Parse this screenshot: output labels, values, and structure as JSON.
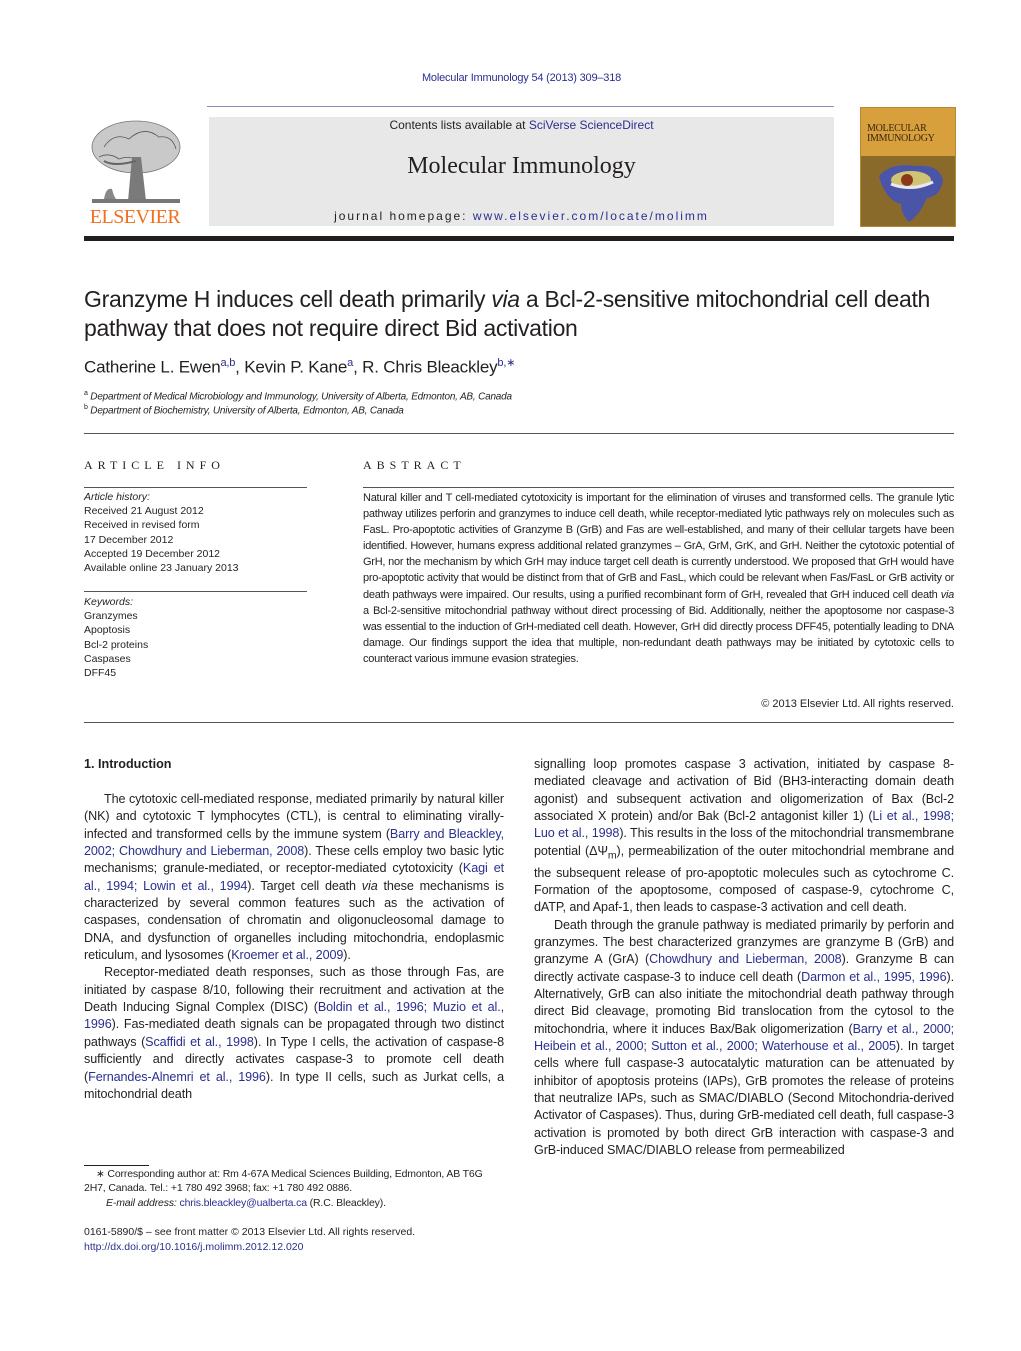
{
  "header": {
    "journal_ref": "Molecular Immunology 54 (2013) 309–318",
    "contents_prefix": "Contents lists available at ",
    "contents_link": "SciVerse ScienceDirect",
    "journal_title": "Molecular Immunology",
    "homepage_prefix": "journal homepage: ",
    "homepage_link": "www.elsevier.com/locate/molimm",
    "publisher_logo_text": "ELSEVIER",
    "cover_title_line1": "MOLECULAR",
    "cover_title_line2": "IMMUNOLOGY",
    "colors": {
      "link": "#2a2f8f",
      "elsevier_orange": "#f26f21",
      "header_box": "#e8e8e8"
    }
  },
  "article": {
    "title_part1": "Granzyme H induces cell death primarily ",
    "title_italic": "via",
    "title_part2": " a Bcl-2-sensitive mitochondrial cell death pathway that does not require direct Bid activation",
    "authors": [
      {
        "name": "Catherine L. Ewen",
        "sup": "a,b",
        "sep": ", "
      },
      {
        "name": "Kevin P. Kane",
        "sup": "a",
        "sep": ", "
      },
      {
        "name": "R. Chris Bleackley",
        "sup": "b,∗",
        "sep": ""
      }
    ],
    "affiliations": [
      {
        "sup": "a",
        "text": "Department of Medical Microbiology and Immunology, University of Alberta, Edmonton, AB, Canada"
      },
      {
        "sup": "b",
        "text": "Department of Biochemistry, University of Alberta, Edmonton, AB, Canada"
      }
    ]
  },
  "article_info": {
    "heading": "ARTICLE INFO",
    "history_label": "Article history:",
    "history": [
      "Received 21 August 2012",
      "Received in revised form",
      "17 December 2012",
      "Accepted 19 December 2012",
      "Available online 23 January 2013"
    ],
    "keywords_label": "Keywords:",
    "keywords": [
      "Granzymes",
      "Apoptosis",
      "Bcl-2 proteins",
      "Caspases",
      "DFF45"
    ]
  },
  "abstract": {
    "heading": "ABSTRACT",
    "text_part1": "Natural killer and T cell-mediated cytotoxicity is important for the elimination of viruses and transformed cells. The granule lytic pathway utilizes perforin and granzymes to induce cell death, while receptor-mediated lytic pathways rely on molecules such as FasL. Pro-apoptotic activities of Granzyme B (GrB) and Fas are well-established, and many of their cellular targets have been identified. However, humans express additional related granzymes – GrA, GrM, GrK, and GrH. Neither the cytotoxic potential of GrH, nor the mechanism by which GrH may induce target cell death is currently understood. We proposed that GrH would have pro-apoptotic activity that would be distinct from that of GrB and FasL, which could be relevant when Fas/FasL or GrB activity or death pathways were impaired. Our results, using a purified recombinant form of GrH, revealed that GrH induced cell death ",
    "text_italic": "via",
    "text_part2": " a Bcl-2-sensitive mitochondrial pathway without direct processing of Bid. Additionally, neither the apoptosome nor caspase-3 was essential to the induction of GrH-mediated cell death. However, GrH did directly process DFF45, potentially leading to DNA damage. Our findings support the idea that multiple, non-redundant death pathways may be initiated by cytotoxic cells to counteract various immune evasion strategies.",
    "copyright": "© 2013 Elsevier Ltd. All rights reserved."
  },
  "body": {
    "section_heading": "1.  Introduction",
    "left": {
      "p1": {
        "t1": "The cytotoxic cell-mediated response, mediated primarily by natural killer (NK) and cytotoxic T lymphocytes (CTL), is central to eliminating virally-infected and transformed cells by the immune system (",
        "c1": "Barry and Bleackley, 2002; Chowdhury and Lieberman, 2008",
        "t2": "). These cells employ two basic lytic mechanisms; granule-mediated, or receptor-mediated cytotoxicity (",
        "c2": "Kagi et al., 1994; Lowin et al., 1994",
        "t3": "). Target cell death ",
        "it": "via",
        "t4": " these mechanisms is characterized by several common features such as the activation of caspases, condensation of chromatin and oligonucleosomal damage to DNA, and dysfunction of organelles including mitochondria, endoplasmic reticulum, and lysosomes (",
        "c3": "Kroemer et al., 2009",
        "t5": ")."
      },
      "p2": {
        "t1": "Receptor-mediated death responses, such as those through Fas, are initiated by caspase 8/10, following their recruitment and activation at the Death Inducing Signal Complex (DISC) (",
        "c1": "Boldin et al., 1996; Muzio et al., 1996",
        "t2": "). Fas-mediated death signals can be propagated through two distinct pathways (",
        "c2": "Scaffidi et al., 1998",
        "t3": "). In Type I cells, the activation of caspase-8 sufficiently and directly activates caspase-3 to promote cell death (",
        "c3": "Fernandes-Alnemri et al., 1996",
        "t4": "). In type II cells, such as Jurkat cells, a mitochondrial death"
      }
    },
    "right": {
      "p1": {
        "t1": "signalling loop promotes caspase 3 activation, initiated by caspase 8-mediated cleavage and activation of Bid (BH3-interacting domain death agonist) and subsequent activation and oligomerization of Bax (Bcl-2 associated X protein) and/or Bak (Bcl-2 antagonist killer 1) (",
        "c1": "Li et al., 1998; Luo et al., 1998",
        "t2": "). This results in the loss of the mitochondrial transmembrane potential (ΔΨ",
        "sub": "m",
        "t3": "), permeabilization of the outer mitochondrial membrane and the subsequent release of pro-apoptotic molecules such as cytochrome C. Formation of the apoptosome, composed of caspase-9, cytochrome C, dATP, and Apaf-1, then leads to caspase-3 activation and cell death."
      },
      "p2": {
        "t1": "Death through the granule pathway is mediated primarily by perforin and granzymes. The best characterized granzymes are granzyme B (GrB) and granzyme A (GrA) (",
        "c1": "Chowdhury and Lieberman, 2008",
        "t2": "). Granzyme B can directly activate caspase-3 to induce cell death (",
        "c2": "Darmon et al., 1995, 1996",
        "t3": "). Alternatively, GrB can also initiate the mitochondrial death pathway through direct Bid cleavage, promoting Bid translocation from the cytosol to the mitochondria, where it induces Bax/Bak oligomerization (",
        "c3": "Barry et al., 2000; Heibein et al., 2000; Sutton et al., 2000; Waterhouse et al., 2005",
        "t4": "). In target cells where full caspase-3 autocatalytic maturation can be attenuated by inhibitor of apoptosis proteins (IAPs), GrB promotes the release of proteins that neutralize IAPs, such as SMAC/DIABLO (Second Mitochondria-derived Activator of Caspases). Thus, during GrB-mediated cell death, full caspase-3 activation is promoted by both direct GrB interaction with caspase-3 and GrB-induced SMAC/DIABLO release from permeabilized"
      }
    }
  },
  "footnote": {
    "corresponding": "∗ Corresponding author at: Rm 4-67A Medical Sciences Building, Edmonton, AB T6G 2H7, Canada. Tel.: +1 780 492 3968; fax: +1 780 492 0886.",
    "email_label": "E-mail address: ",
    "email": "chris.bleackley@ualberta.ca",
    "email_suffix": " (R.C. Bleackley)."
  },
  "bottom": {
    "issn_line": "0161-5890/$ – see front matter © 2013 Elsevier Ltd. All rights reserved.",
    "doi": "http://dx.doi.org/10.1016/j.molimm.2012.12.020"
  }
}
